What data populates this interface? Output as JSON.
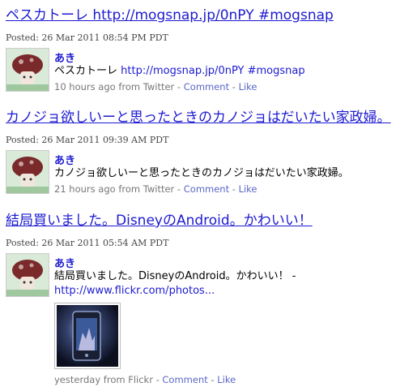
{
  "posts": [
    {
      "title": "ペスカトーレ http://mogsnap.jp/0nPY #mogsnap",
      "posted": "Posted: 26 Mar 2011 08:54 PM PDT",
      "user": "あき",
      "body_text": "ペスカトーレ ",
      "body_link": "http://mogsnap.jp/0nPY #mogsnap",
      "time": "10 hours ago from Twitter",
      "sep1": " - ",
      "comment": "Comment",
      "sep2": " - ",
      "like": "Like"
    },
    {
      "title": "カノジョ欲しいーと思ったときのカノジョはだいたい家政婦。",
      "posted": "Posted: 26 Mar 2011 09:39 AM PDT",
      "user": "あき",
      "body_text": "カノジョ欲しいーと思ったときのカノジョはだいたい家政婦。",
      "time": "21 hours ago from Twitter",
      "sep1": " - ",
      "comment": "Comment",
      "sep2": " - ",
      "like": "Like"
    },
    {
      "title": "結局買いました。DisneyのAndroid。かわいい！",
      "posted": "Posted: 26 Mar 2011 05:54 AM PDT",
      "user": "あき",
      "body_text": "結局買いました。DisneyのAndroid。かわいい！ -",
      "body_link": "http://www.flickr.com/photos...",
      "time": "yesterday from Flickr",
      "sep1": " - ",
      "comment": "Comment",
      "sep2": " - ",
      "like": "Like"
    }
  ]
}
